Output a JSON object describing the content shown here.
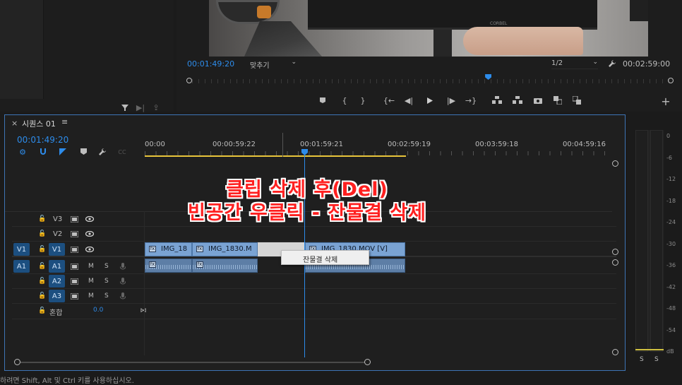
{
  "program_monitor": {
    "timecode": "00:01:49:20",
    "fit_label": "맞추기",
    "resolution": "1/2",
    "duration": "00:02:59:00",
    "monitor_brand": "CORBEL",
    "playhead_fraction": 0.62
  },
  "sequence": {
    "tab_title": "시퀀스 01",
    "close_symbol": "×",
    "menu_symbol": "≡",
    "timecode": "00:01:49:20",
    "ruler": [
      "00:00",
      "00:00:59:22",
      "00:01:59:21",
      "00:02:59:19",
      "00:03:59:18",
      "00:04:59:16"
    ],
    "tracks": {
      "video": [
        "V3",
        "V2",
        "V1"
      ],
      "audio": [
        "A1",
        "A2",
        "A3"
      ],
      "source_v": "V1",
      "source_a": "A1",
      "mute": "M",
      "solo": "S",
      "mix_label": "혼합",
      "mix_value": "0.0"
    },
    "clips": {
      "v1_a": "IMG_18",
      "v1_b": "IMG_1830.M",
      "v1_c": "IMG_1830.MOV [V]",
      "fx": "fx"
    },
    "context_menu": {
      "item": "잔물결 삭제"
    }
  },
  "overlay": {
    "line1": "클립 삭제 후(Del)",
    "line2": "빈공간 우클릭 - 잔물결 삭제"
  },
  "audio_meter": {
    "scale": [
      "0",
      "-6",
      "-12",
      "-18",
      "-24",
      "-30",
      "-36",
      "-42",
      "-48",
      "-54",
      "dB"
    ],
    "solo_left": "S",
    "solo_right": "S"
  },
  "status_bar": {
    "text": "하려면 Shift, Alt 및 Ctrl 키를 사용하십시오."
  },
  "colors": {
    "accent": "#2d8ceb",
    "clip_video": "#7aa3d3",
    "clip_audio": "#5d7ea6",
    "overlay_text": "#ff2020",
    "work_area": "#e8c43a"
  }
}
